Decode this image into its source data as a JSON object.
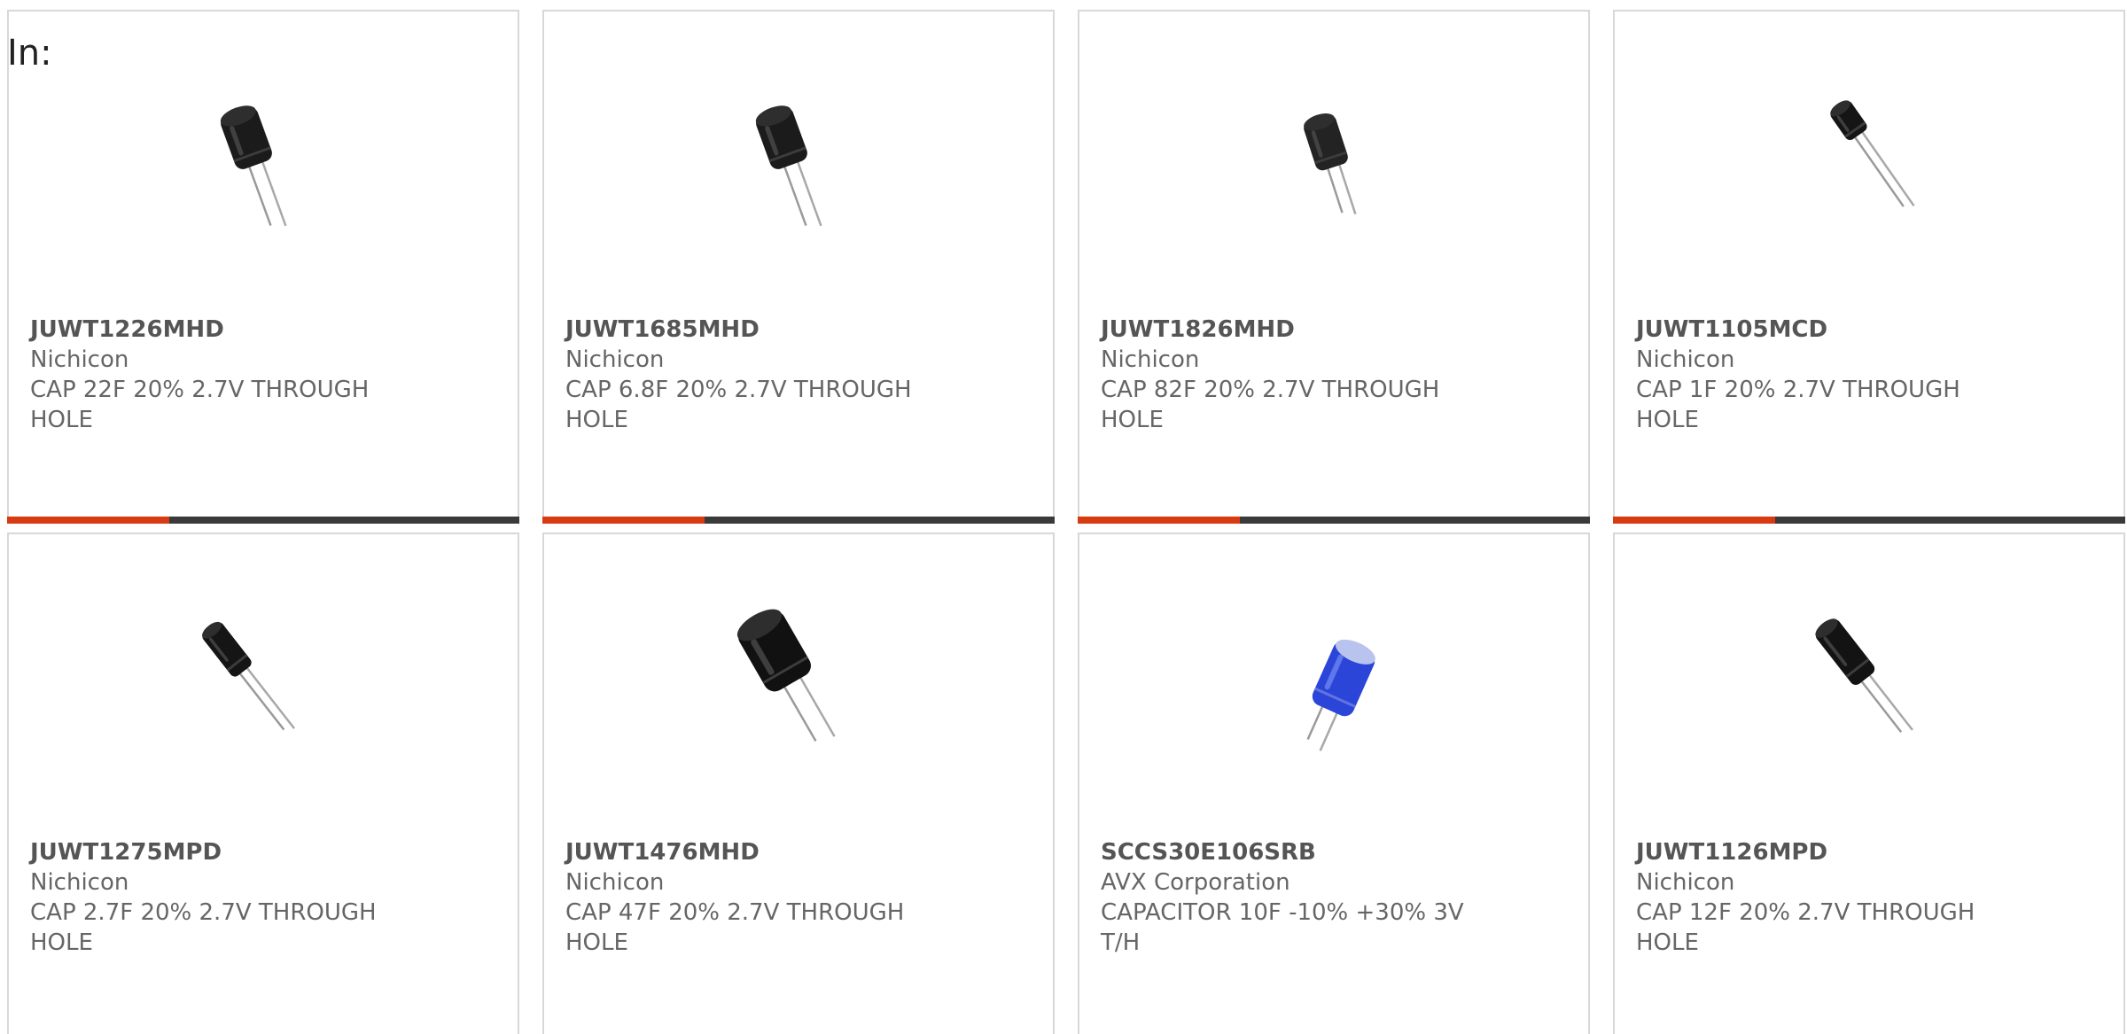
{
  "filter_label": "In:",
  "colors": {
    "accent": "#d83a12",
    "bar": "#3a3a3a",
    "text": "#666666"
  },
  "products": [
    {
      "part_number": "JUWT1226MHD",
      "manufacturer": "Nichicon",
      "description": "CAP 22F 20% 2.7V THROUGH HOLE",
      "image": "black-radial-capacitor-icon"
    },
    {
      "part_number": "JUWT1685MHD",
      "manufacturer": "Nichicon",
      "description": "CAP 6.8F 20% 2.7V THROUGH HOLE",
      "image": "black-radial-capacitor-icon"
    },
    {
      "part_number": "JUWT1826MHD",
      "manufacturer": "Nichicon",
      "description": "CAP 82F 20% 2.7V THROUGH HOLE",
      "image": "black-radial-capacitor-icon"
    },
    {
      "part_number": "JUWT1105MCD",
      "manufacturer": "Nichicon",
      "description": "CAP 1F 20% 2.7V THROUGH HOLE",
      "image": "black-radial-capacitor-icon"
    },
    {
      "part_number": "JUWT1275MPD",
      "manufacturer": "Nichicon",
      "description": "CAP 2.7F 20% 2.7V THROUGH HOLE",
      "image": "black-radial-capacitor-icon"
    },
    {
      "part_number": "JUWT1476MHD",
      "manufacturer": "Nichicon",
      "description": "CAP 47F 20% 2.7V THROUGH HOLE",
      "image": "black-radial-capacitor-icon"
    },
    {
      "part_number": "SCCS30E106SRB",
      "manufacturer": "AVX Corporation",
      "description": "CAPACITOR 10F -10% +30% 3V T/H",
      "image": "blue-radial-capacitor-icon"
    },
    {
      "part_number": "JUWT1126MPD",
      "manufacturer": "Nichicon",
      "description": "CAP 12F 20% 2.7V THROUGH HOLE",
      "image": "black-radial-capacitor-icon"
    }
  ]
}
